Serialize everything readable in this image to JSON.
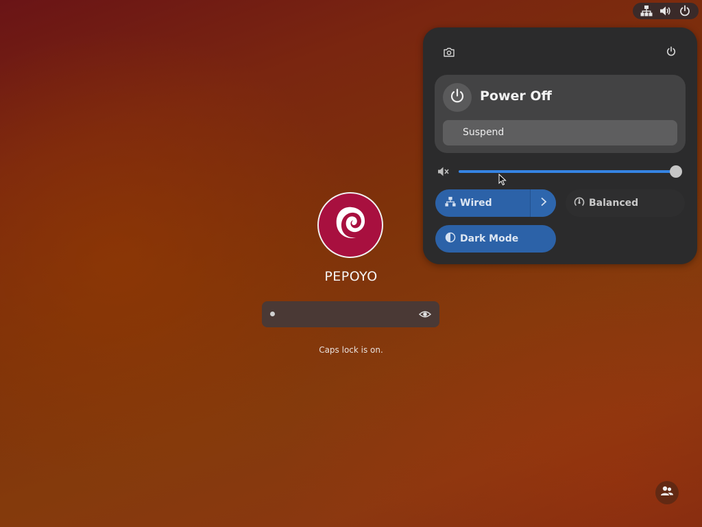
{
  "top_bar": {
    "indicators": [
      "network-wired-icon",
      "volume-icon",
      "power-icon"
    ]
  },
  "quick_settings": {
    "power_menu": {
      "title": "Power Off",
      "items": [
        {
          "label": "Suspend"
        }
      ]
    },
    "volume": {
      "level": 1.0
    },
    "tiles": {
      "wired": {
        "label": "Wired",
        "active": true
      },
      "balanced": {
        "label": "Balanced",
        "active": false
      },
      "dark_mode": {
        "label": "Dark Mode",
        "active": true
      }
    }
  },
  "login": {
    "username": "PEPOYO",
    "password_masked": "•",
    "caps_lock_message": "Caps lock is on."
  },
  "colors": {
    "accent": "#3584e4",
    "avatar_background": "#a8103f"
  }
}
